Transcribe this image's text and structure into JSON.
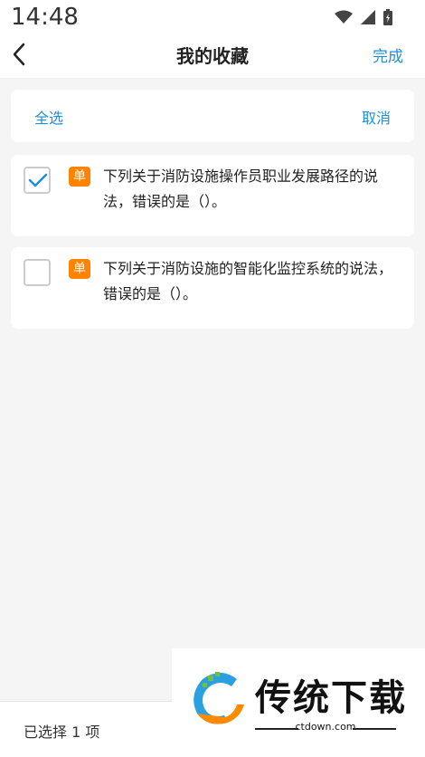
{
  "status_bar": {
    "time": "14:48"
  },
  "header": {
    "title": "我的收藏",
    "done_label": "完成"
  },
  "actions": {
    "select_all_label": "全选",
    "cancel_label": "取消"
  },
  "items": [
    {
      "checked": true,
      "type_badge": "单",
      "text": "下列关于消防设施操作员职业发展路径的说法，错误的是（）。"
    },
    {
      "checked": false,
      "type_badge": "单",
      "text": "下列关于消防设施的智能化监控系统的说法，错误的是（）。"
    }
  ],
  "footer": {
    "selected_count_text": "已选择 1 项"
  },
  "watermark": {
    "title": "传统下载",
    "url": "ctdown.com"
  },
  "colors": {
    "accent": "#1f8fd8",
    "badge": "#ff8200",
    "check": "#1f8fd8"
  }
}
